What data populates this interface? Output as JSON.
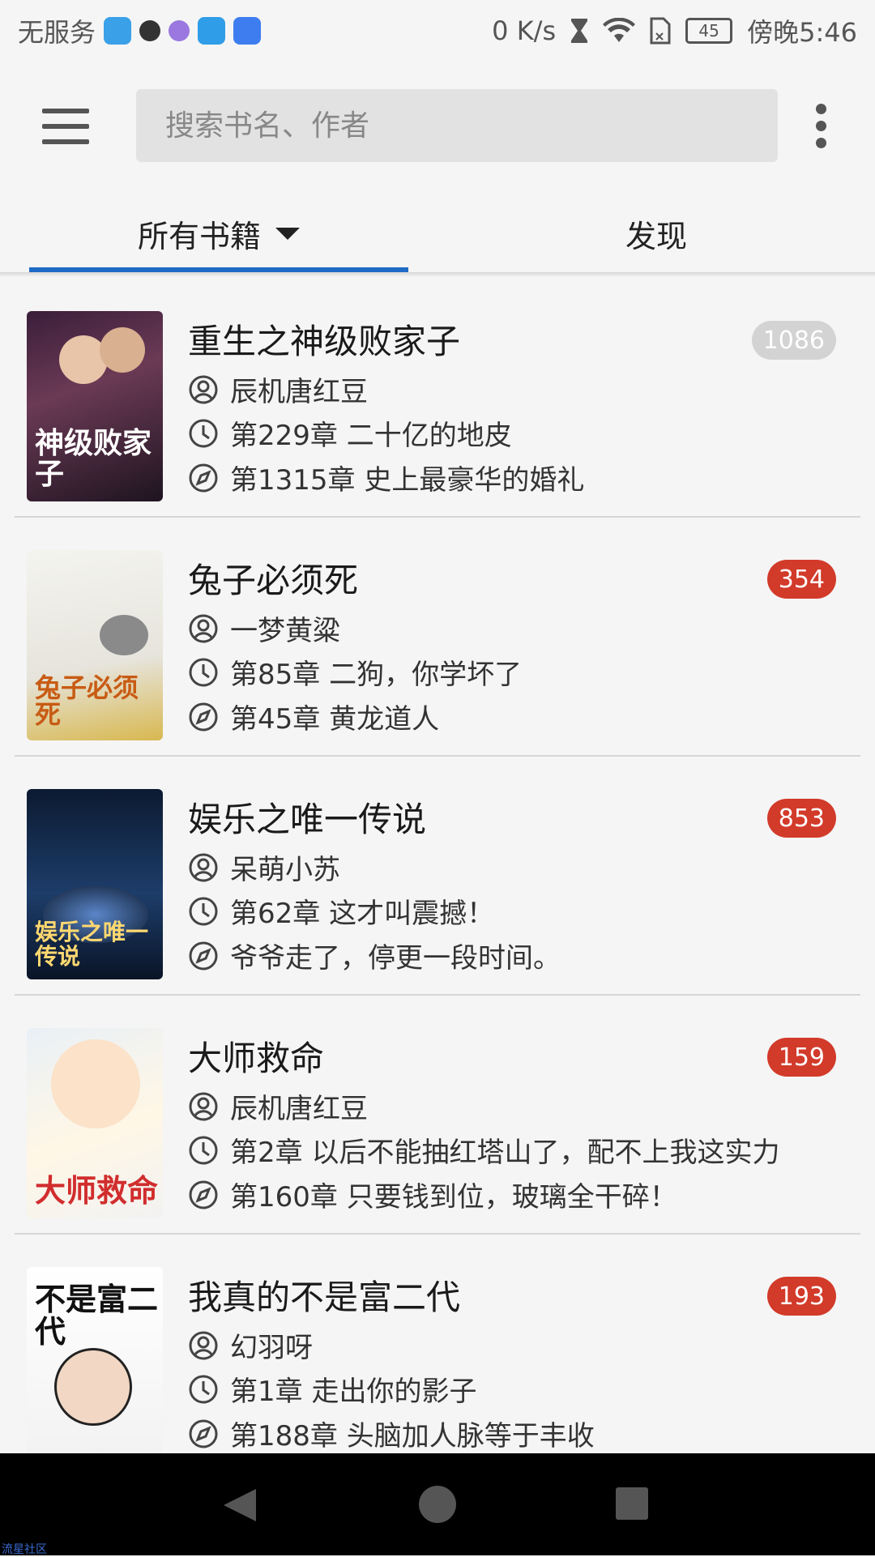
{
  "status_bar": {
    "carrier": "无服务",
    "speed": "0 K/s",
    "battery": "45",
    "time": "傍晚5:46"
  },
  "toolbar": {
    "search_placeholder": "搜索书名、作者"
  },
  "tabs": [
    {
      "label": "所有书籍",
      "selected": true
    },
    {
      "label": "发现",
      "selected": false
    }
  ],
  "books": [
    {
      "title": "重生之神级败家子",
      "author": "辰机唐红豆",
      "last_read": "第229章 二十亿的地皮",
      "latest": "第1315章 史上最豪华的婚礼",
      "badge": "1086",
      "badge_color": "#d3d3d3",
      "cover_text": "神级败家子"
    },
    {
      "title": "兔子必须死",
      "author": "一梦黄粱",
      "last_read": "第85章 二狗，你学坏了",
      "latest": "第45章 黄龙道人",
      "badge": "354",
      "badge_color": "#d23a2a",
      "cover_text": "兔子必须死"
    },
    {
      "title": "娱乐之唯一传说",
      "author": "呆萌小苏",
      "last_read": "第62章 这才叫震撼！",
      "latest": "爷爷走了，停更一段时间。",
      "badge": "853",
      "badge_color": "#d23a2a",
      "cover_text": "娱乐之唯一传说"
    },
    {
      "title": "大师救命",
      "author": "辰机唐红豆",
      "last_read": "第2章 以后不能抽红塔山了，配不上我这实力",
      "latest": "第160章 只要钱到位，玻璃全干碎！",
      "badge": "159",
      "badge_color": "#d23a2a",
      "cover_text": "大师救命"
    },
    {
      "title": "我真的不是富二代",
      "author": "幻羽呀",
      "last_read": "第1章 走出你的影子",
      "latest": "第188章 头脑加人脉等于丰收",
      "badge": "193",
      "badge_color": "#d23a2a",
      "cover_text": "不是富二代"
    }
  ],
  "watermark": "流星社区",
  "colors": {
    "accent": "#1e6bc6",
    "badge_red": "#d23a2a",
    "badge_grey": "#d3d3d3"
  }
}
